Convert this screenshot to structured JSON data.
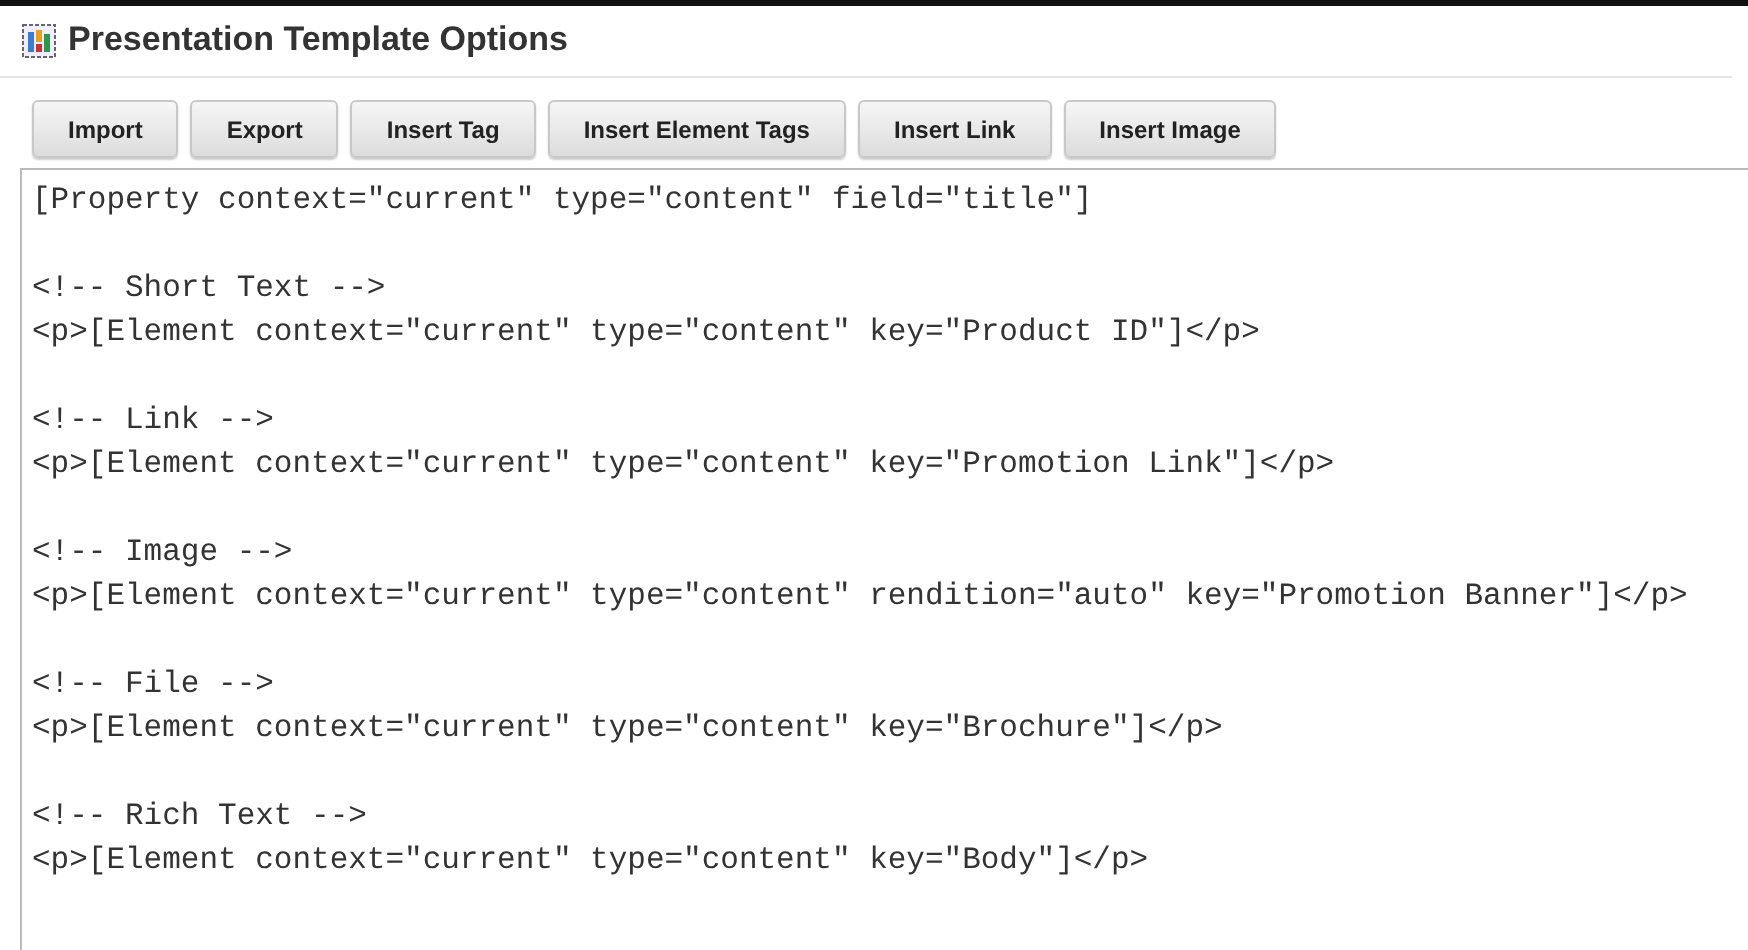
{
  "window": {
    "title": "Presentation Template Options"
  },
  "toolbar": [
    "Import",
    "Export",
    "Insert Tag",
    "Insert Element Tags",
    "Insert Link",
    "Insert Image"
  ],
  "editor": {
    "header": "[Property context=\"current\" type=\"content\" field=\"title\"]",
    "blocks": [
      {
        "comment": "<!-- Short Text -->",
        "code": "<p>[Element context=\"current\" type=\"content\" key=\"Product ID\"]</p>"
      },
      {
        "comment": "<!-- Link -->",
        "code": "<p>[Element context=\"current\" type=\"content\" key=\"Promotion Link\"]</p>"
      },
      {
        "comment": "<!-- Image -->",
        "code": "<p>[Element context=\"current\" type=\"content\" rendition=\"auto\" key=\"Promotion Banner\"]</p>"
      },
      {
        "comment": "<!-- File -->",
        "code": "<p>[Element context=\"current\" type=\"content\" key=\"Brochure\"]</p>"
      },
      {
        "comment": "<!-- Rich Text -->",
        "code": "<p>[Element context=\"current\" type=\"content\" key=\"Body\"]</p>"
      }
    ]
  }
}
